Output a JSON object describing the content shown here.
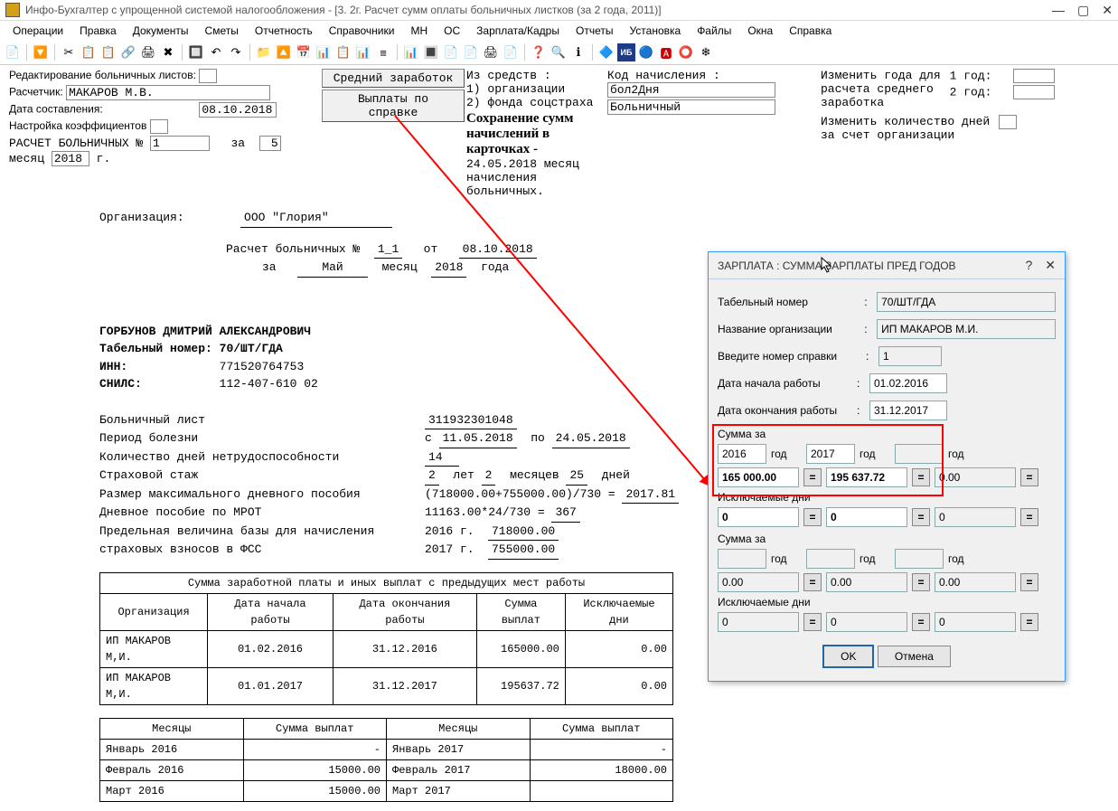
{
  "app": {
    "title": "Инфо-Бухгалтер с упрощенной системой налогообложения - [3. 2г. Расчет сумм оплаты больничных листков (за 2 года, 2011)]"
  },
  "menu": [
    "Операции",
    "Правка",
    "Документы",
    "Сметы",
    "Отчетность",
    "Справочники",
    "МН",
    "ОС",
    "Зарплата/Кадры",
    "Отчеты",
    "Установка",
    "Файлы",
    "Окна",
    "Справка"
  ],
  "toolbar_icons": [
    "📄",
    "🔽",
    "✂",
    "📋",
    "📋",
    "🔗",
    "🖨",
    "✖",
    "🔲",
    "↶",
    "↷",
    "📁",
    "🔼",
    "📅",
    "📊",
    "📋",
    "📊",
    "≡",
    "📊",
    "🔳",
    "📄",
    "📄",
    "🖨",
    "📄",
    "❓",
    "🔍",
    "ℹ",
    "🔷",
    "ИБ",
    "🔵",
    "🅰",
    "⭕",
    "❄"
  ],
  "header": {
    "edit_label": "Редактирование больничных листов:",
    "calc_label": "Расчетчик:",
    "calc_value": "МАКАРОВ М.В.",
    "date_label": "Дата составления:",
    "date_value": "08.10.2018",
    "coef_label": "Настройка коэффициентов",
    "calc_sick_label": "РАСЧЕТ БОЛЬНИЧНЫХ №",
    "calc_sick_num": "1",
    "za": "за",
    "month_num": "5",
    "month_word": "месяц",
    "year_val": "2018",
    "year_suffix": "г.",
    "btn_avg": "Средний заработок",
    "btn_pay_ref": "Выплаты по справке",
    "funds_label": "Из средств :",
    "funds_1": "1) организации",
    "funds_2": "2) фонда соцстраха",
    "save_heading": "Сохранение сумм начислений в карточках -",
    "save_sub": "24.05.2018 месяц начисления больничных.",
    "code_label": "Код начисления :",
    "code_1": "бол2Дня",
    "code_2": "Больничный",
    "right_block": {
      "l1": "Изменить года для",
      "l2": "расчета среднего",
      "l3": "заработка",
      "y1": "1 год:",
      "y2": "2 год:",
      "l4": "Изменить количество дней",
      "l5": "за счет организации"
    }
  },
  "doc": {
    "org_label": "Организация:",
    "org_value": "ООО \"Глория\"",
    "calc_line": "Расчет больничных №",
    "calc_num": "1_1",
    "ot": "от",
    "calc_date": "08.10.2018",
    "za": "за",
    "month_name": "Май",
    "mes_word": "месяц",
    "year_u": "2018",
    "goda": "года",
    "person": "ГОРБУНОВ ДМИТРИЙ АЛЕКСАНДРОВИЧ",
    "tab_label": "Табельный номер:",
    "tab_val": "70/ШТ/ГДА",
    "inn_label": "ИНН:",
    "inn_val": "771520764753",
    "snils_label": "СНИЛС:",
    "snils_val": "112-407-610 02",
    "sick_label": "Больничный лист",
    "sick_num": "311932301048",
    "period_label": "Период болезни",
    "period_from_l": "с",
    "period_from": "11.05.2018",
    "period_to_l": "по",
    "period_to": "24.05.2018",
    "days_label": "Количество дней нетрудоспособности",
    "days_val": "14",
    "stage_label": "Страховой стаж",
    "stage_y": "2",
    "stage_y_w": "лет",
    "stage_m": "2",
    "stage_m_w": "месяцев",
    "stage_d": "25",
    "stage_d_w": "дней",
    "max_label": "Размер максимального дневного пособия",
    "max_calc": "(718000.00+755000.00)/730 =",
    "max_val": "2017.81",
    "mrot_label": "Дневное пособие по МРОТ",
    "mrot_calc": "11163.00*24/730 =",
    "mrot_val": "367",
    "base_label1": "Предельная величина базы для начисления",
    "base_label2": "страховых взносов в ФСС",
    "base_y1": "2016 г.",
    "base_v1": "718000.00",
    "base_y2": "2017 г.",
    "base_v2": "755000.00",
    "tbl1_title": "Сумма заработной платы и иных выплат с предыдущих мест работы",
    "tbl1_headers": [
      "Организация",
      "Дата начала работы",
      "Дата окончания работы",
      "Сумма выплат",
      "Исключаемые дни"
    ],
    "tbl1_rows": [
      [
        "ИП МАКАРОВ М,И.",
        "01.02.2016",
        "31.12.2016",
        "165000.00",
        "0.00"
      ],
      [
        "ИП МАКАРОВ М,И.",
        "01.01.2017",
        "31.12.2017",
        "195637.72",
        "0.00"
      ]
    ],
    "tbl2_headers": [
      "Месяцы",
      "Сумма выплат",
      "Месяцы",
      "Сумма выплат"
    ],
    "tbl2_rows": [
      [
        "Январь 2016",
        "-",
        "Январь 2017",
        "-"
      ],
      [
        "Февраль 2016",
        "15000.00",
        "Февраль 2017",
        "18000.00"
      ],
      [
        "Март 2016",
        "15000.00",
        "Март 2017",
        ""
      ]
    ]
  },
  "dialog": {
    "title": "ЗАРПЛАТА : СУММА ЗАРПЛАТЫ ПРЕД ГОДОВ",
    "tab_label": "Табельный номер",
    "tab_val": "70/ШТ/ГДА",
    "org_label": "Название организации",
    "org_val": "ИП МАКАРОВ М.И.",
    "ref_label": "Введите номер справки",
    "ref_val": "1",
    "start_label": "Дата начала работы",
    "start_val": "01.02.2016",
    "end_label": "Дата окончания работы",
    "end_val": "31.12.2017",
    "sum_for": "Сумма за",
    "year_word": "год",
    "y1": "2016",
    "v1": "165 000.00",
    "y2": "2017",
    "v2": "195 637.72",
    "v3": "0.00",
    "excl_label": "Исключаемые дни",
    "zero": "0",
    "s2_v": "0.00",
    "ok": "OK",
    "cancel": "Отмена"
  }
}
